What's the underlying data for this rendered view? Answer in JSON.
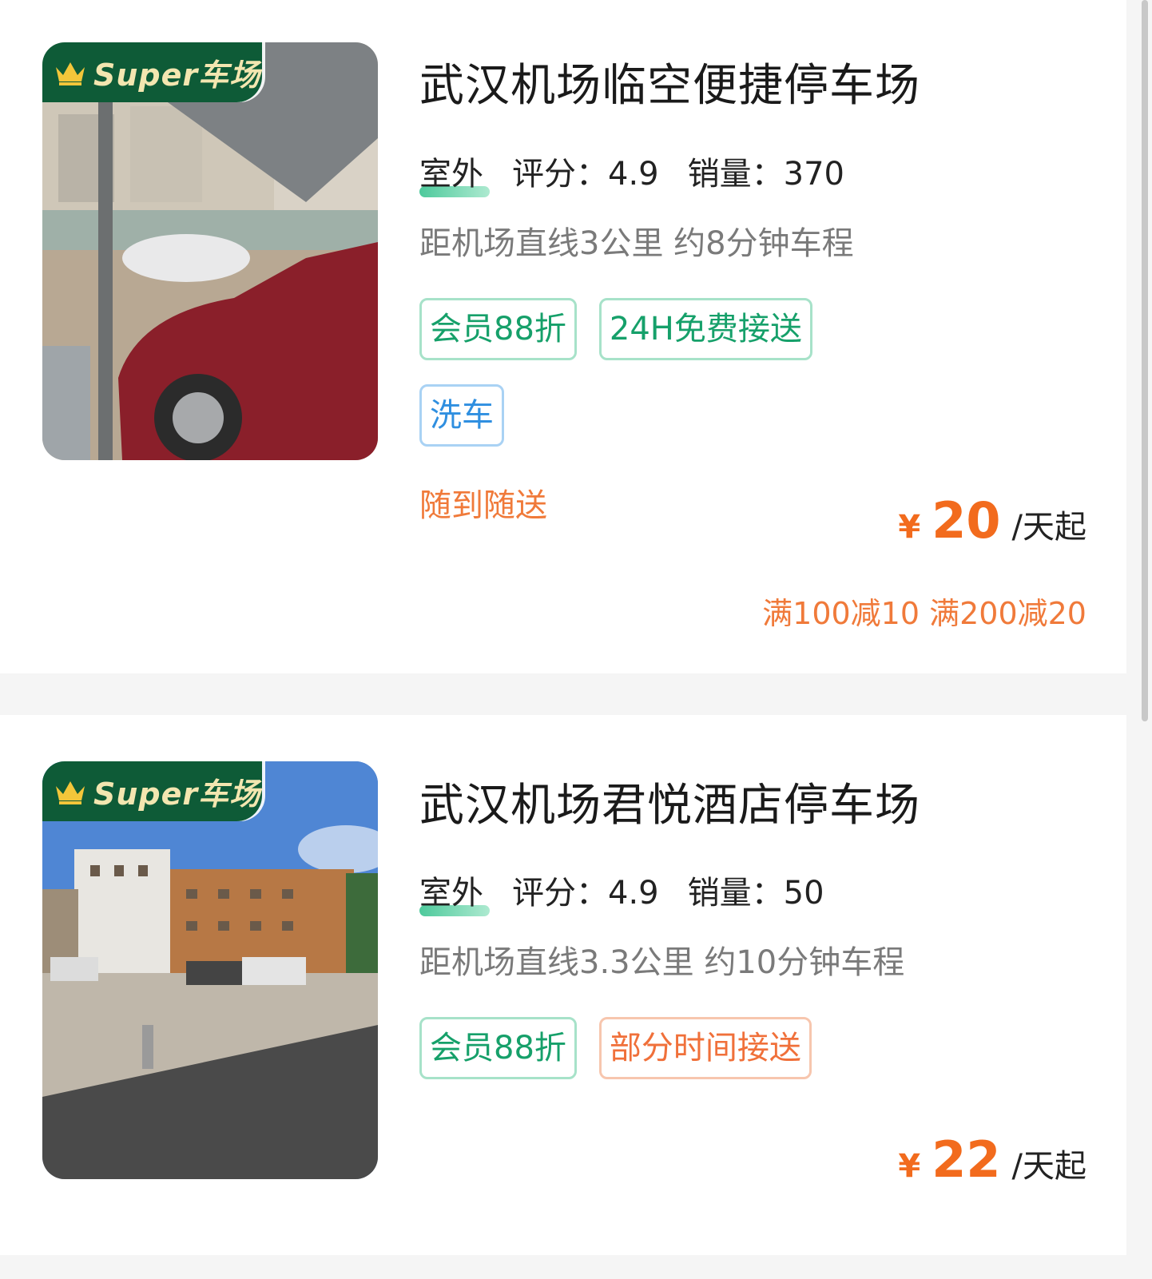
{
  "listings": [
    {
      "badge_text": "Super车场",
      "name": "武汉机场临空便捷停车场",
      "location_type": "室外",
      "rating_label": "评分：",
      "rating": "4.9",
      "sales_label": "销量：",
      "sales": "370",
      "distance": "距机场直线3公里 约8分钟车程",
      "tags": [
        {
          "text": "会员88折",
          "style": "green"
        },
        {
          "text": "24H免费接送",
          "style": "green"
        },
        {
          "text": "洗车",
          "style": "blue"
        }
      ],
      "pickup_note": "随到随送",
      "currency": "¥",
      "price": "20",
      "price_unit": "/天起",
      "promo": "满100减10 满200减20"
    },
    {
      "badge_text": "Super车场",
      "name": "武汉机场君悦酒店停车场",
      "location_type": "室外",
      "rating_label": "评分：",
      "rating": "4.9",
      "sales_label": "销量：",
      "sales": "50",
      "distance": "距机场直线3.3公里 约10分钟车程",
      "tags": [
        {
          "text": "会员88折",
          "style": "green"
        },
        {
          "text": "部分时间接送",
          "style": "orange"
        }
      ],
      "currency": "¥",
      "price": "22",
      "price_unit": "/天起"
    }
  ],
  "colors": {
    "accent": "#f26b1d",
    "badge_bg": "#0e5b37",
    "tag_green": "#16a06a",
    "tag_blue": "#2f8fe0",
    "tag_orange": "#f0703a"
  }
}
